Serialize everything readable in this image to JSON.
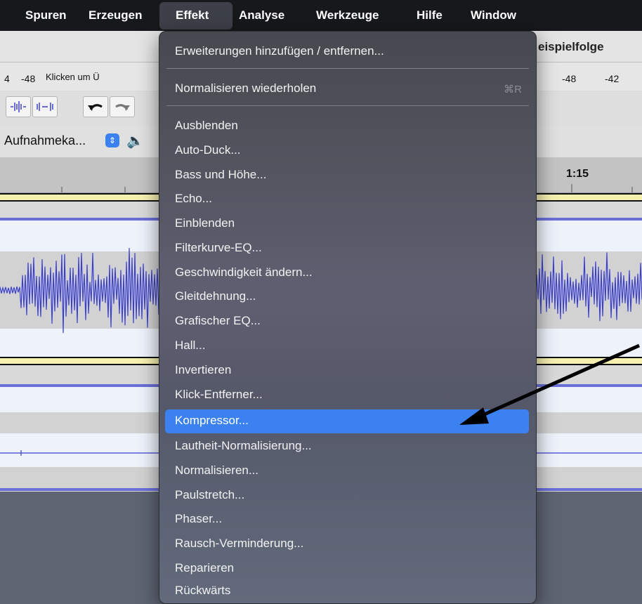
{
  "menubar": {
    "items": [
      {
        "label": "Spuren",
        "active": false
      },
      {
        "label": "Erzeugen",
        "active": false
      },
      {
        "label": "Effekt",
        "active": true
      },
      {
        "label": "Analyse",
        "active": false
      },
      {
        "label": "Werkzeuge",
        "active": false
      },
      {
        "label": "Hilfe",
        "active": false
      },
      {
        "label": "Window",
        "active": false
      }
    ]
  },
  "window": {
    "title_fragment": "eispielfolge"
  },
  "meter": {
    "labels": [
      "4",
      "-48",
      "-48",
      "-42"
    ],
    "click_hint": "Klicken um Ü"
  },
  "toolbar": {
    "device_label": "Aufnahmeka...",
    "select_icon": "up-down-chevron-icon",
    "speaker_icon": "speaker-icon"
  },
  "timeline": {
    "time_label": "1:15"
  },
  "effekt_menu": {
    "top_items": [
      {
        "label": "Erweiterungen hinzufügen / entfernen..."
      },
      {
        "label": "Normalisieren wiederholen",
        "shortcut": "⌘R"
      }
    ],
    "effects": [
      {
        "label": "Ausblenden"
      },
      {
        "label": "Auto-Duck..."
      },
      {
        "label": "Bass und Höhe..."
      },
      {
        "label": "Echo..."
      },
      {
        "label": "Einblenden"
      },
      {
        "label": "Filterkurve-EQ..."
      },
      {
        "label": "Geschwindigkeit ändern..."
      },
      {
        "label": "Gleitdehnung..."
      },
      {
        "label": "Grafischer EQ..."
      },
      {
        "label": "Hall..."
      },
      {
        "label": "Invertieren"
      },
      {
        "label": "Klick-Entferner..."
      },
      {
        "label": "Kompressor...",
        "highlighted": true
      },
      {
        "label": "Lautheit-Normalisierung..."
      },
      {
        "label": "Normalisieren..."
      },
      {
        "label": "Paulstretch..."
      },
      {
        "label": "Phaser..."
      },
      {
        "label": "Rausch-Verminderung..."
      },
      {
        "label": "Reparieren"
      },
      {
        "label": "Rückwärts"
      }
    ]
  },
  "colors": {
    "highlight": "#3b82f0",
    "waveform": "#3b3fd0",
    "menubar": "#17181c"
  }
}
